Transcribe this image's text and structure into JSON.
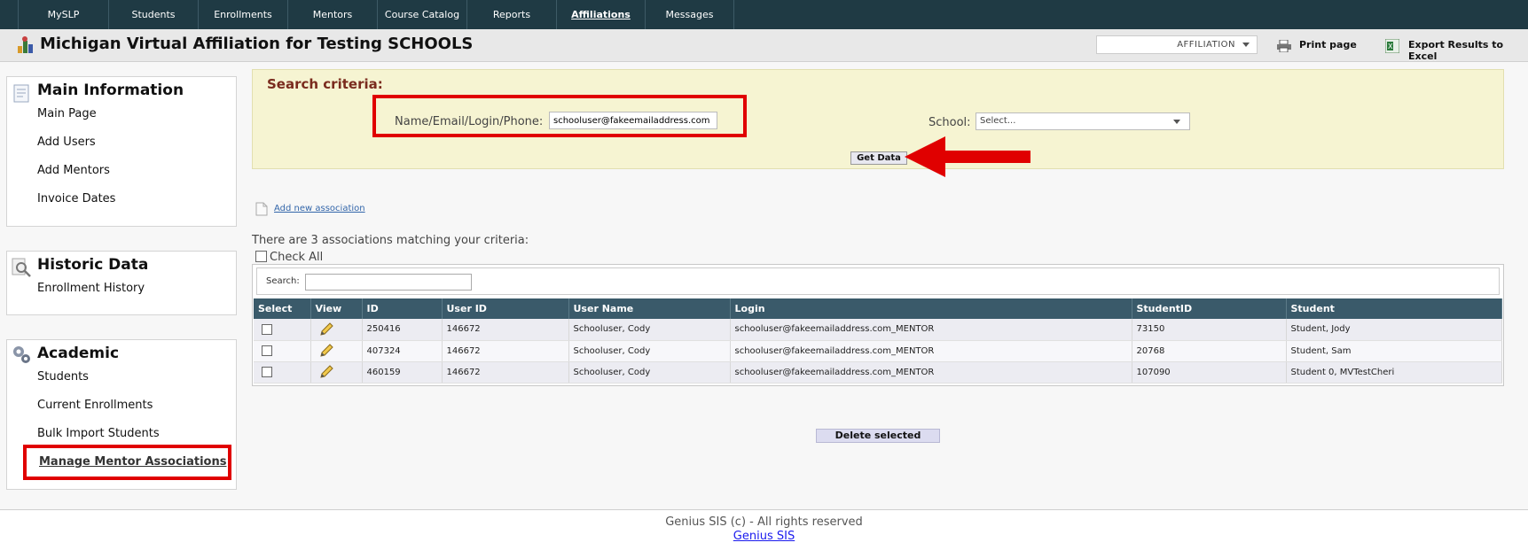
{
  "nav": {
    "tabs": [
      {
        "label": "MySLP"
      },
      {
        "label": "Students"
      },
      {
        "label": "Enrollments"
      },
      {
        "label": "Mentors"
      },
      {
        "label": "Course Catalog"
      },
      {
        "label": "Reports"
      },
      {
        "label": "Affiliations",
        "active": true
      },
      {
        "label": "Messages"
      }
    ]
  },
  "header": {
    "title": "Michigan Virtual Affiliation for Testing SCHOOLS",
    "role_select": "AFFILIATION",
    "print_label": "Print page",
    "export_label": "Export Results to Excel"
  },
  "sidebar": {
    "main": {
      "heading": "Main Information",
      "items": [
        "Main Page",
        "Add Users",
        "Add Mentors",
        "Invoice Dates"
      ]
    },
    "historic": {
      "heading": "Historic Data",
      "items": [
        "Enrollment History"
      ]
    },
    "academic": {
      "heading": "Academic",
      "items": [
        "Students",
        "Current Enrollments",
        "Bulk Import Students",
        "Manage Mentor Associations"
      ]
    }
  },
  "criteria": {
    "title": "Search criteria:",
    "name_label": "Name/Email/Login/Phone:",
    "name_value": "schooluser@fakeemailaddress.com",
    "school_label": "School:",
    "school_value": "Select...",
    "get_data_label": "Get Data"
  },
  "add_association_label": "Add new association",
  "match_text": "There are 3 associations matching your criteria:",
  "check_all_label": "Check All",
  "grid": {
    "search_label": "Search:",
    "columns": [
      "Select",
      "View",
      "ID",
      "User ID",
      "User Name",
      "Login",
      "StudentID",
      "Student"
    ],
    "rows": [
      {
        "id": "250416",
        "user_id": "146672",
        "user_name": "Schooluser, Cody",
        "login": "schooluser@fakeemailaddress.com_MENTOR",
        "student_id": "73150",
        "student": "Student, Jody"
      },
      {
        "id": "407324",
        "user_id": "146672",
        "user_name": "Schooluser, Cody",
        "login": "schooluser@fakeemailaddress.com_MENTOR",
        "student_id": "20768",
        "student": "Student, Sam"
      },
      {
        "id": "460159",
        "user_id": "146672",
        "user_name": "Schooluser, Cody",
        "login": "schooluser@fakeemailaddress.com_MENTOR",
        "student_id": "107090",
        "student": "Student 0, MVTestCheri"
      }
    ]
  },
  "delete_label": "Delete selected",
  "footer": {
    "copyright": "Genius SIS (c) - All rights reserved",
    "link": "Genius SIS"
  },
  "colors": {
    "nav_bg": "#1f3a44",
    "grid_header": "#3a5a6a",
    "criteria_bg": "#f6f4d2",
    "criteria_title": "#7a2b1e",
    "highlight_red": "#e00000"
  }
}
